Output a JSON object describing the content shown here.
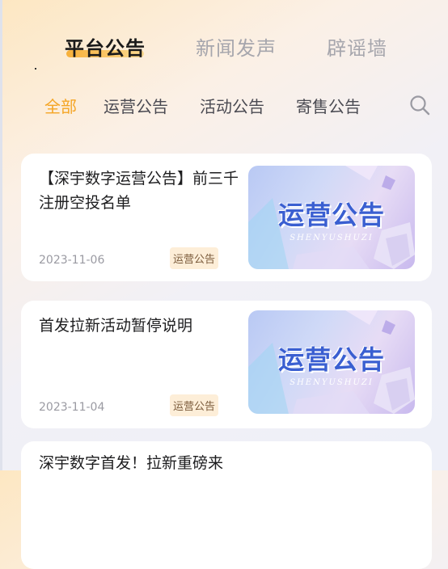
{
  "top_tabs": [
    {
      "label": "平台公告",
      "active": true
    },
    {
      "label": "新闻发声",
      "active": false
    },
    {
      "label": "辟谣墙",
      "active": false
    }
  ],
  "sub_tabs": [
    {
      "label": "全部",
      "active": true
    },
    {
      "label": "运营公告",
      "active": false
    },
    {
      "label": "活动公告",
      "active": false
    },
    {
      "label": "寄售公告",
      "active": false
    }
  ],
  "search": {
    "icon": "search-icon"
  },
  "cards": [
    {
      "title": "【深宇数字运营公告】前三千注册空投名单",
      "date": "2023-11-06",
      "badge": "运营公告",
      "banner_title": "运营公告",
      "banner_sub": "SHENYUSHUZI"
    },
    {
      "title": "首发拉新活动暂停说明",
      "date": "2023-11-04",
      "badge": "运营公告",
      "banner_title": "运营公告",
      "banner_sub": "SHENYUSHUZI"
    },
    {
      "title": "深宇数字首发！拉新重磅来"
    }
  ],
  "colors": {
    "accent": "#f5a524",
    "banner_text": "#3a5fd1",
    "badge_bg": "#fdeed8"
  }
}
